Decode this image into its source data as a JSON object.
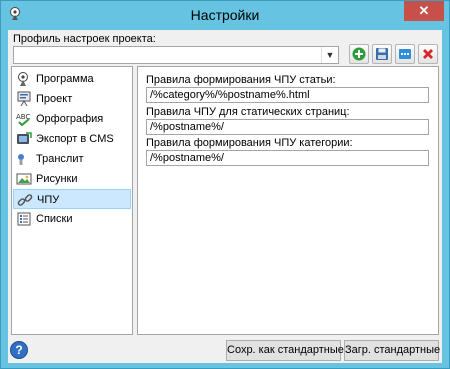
{
  "window": {
    "title": "Настройки",
    "close_label": "✕"
  },
  "profile": {
    "label": "Профиль настроек проекта:",
    "value": ""
  },
  "toolbar": {
    "icons": [
      "add-icon",
      "save-icon",
      "rename-icon",
      "delete-icon"
    ]
  },
  "nav": {
    "items": [
      {
        "label": "Программа",
        "icon": "program-icon"
      },
      {
        "label": "Проект",
        "icon": "project-icon"
      },
      {
        "label": "Орфография",
        "icon": "spellcheck-icon"
      },
      {
        "label": "Экспорт в CMS",
        "icon": "export-cms-icon"
      },
      {
        "label": "Транслит",
        "icon": "translit-icon"
      },
      {
        "label": "Рисунки",
        "icon": "images-icon"
      },
      {
        "label": "ЧПУ",
        "icon": "links-icon",
        "selected": true
      },
      {
        "label": "Списки",
        "icon": "lists-icon"
      }
    ]
  },
  "fields": [
    {
      "label": "Правила формирования ЧПУ статьи:",
      "value": "/%category%/%postname%.html"
    },
    {
      "label": "Правила ЧПУ для статических страниц:",
      "value": "/%postname%/"
    },
    {
      "label": "Правила формирования ЧПУ категории:",
      "value": "/%postname%/"
    }
  ],
  "buttons": {
    "save_default": "Сохр. как стандартные",
    "load_default": "Загр. стандартные",
    "help": "?"
  },
  "colors": {
    "accent": "#66c4e2",
    "selection": "#cce8ff",
    "close": "#c7504a"
  }
}
